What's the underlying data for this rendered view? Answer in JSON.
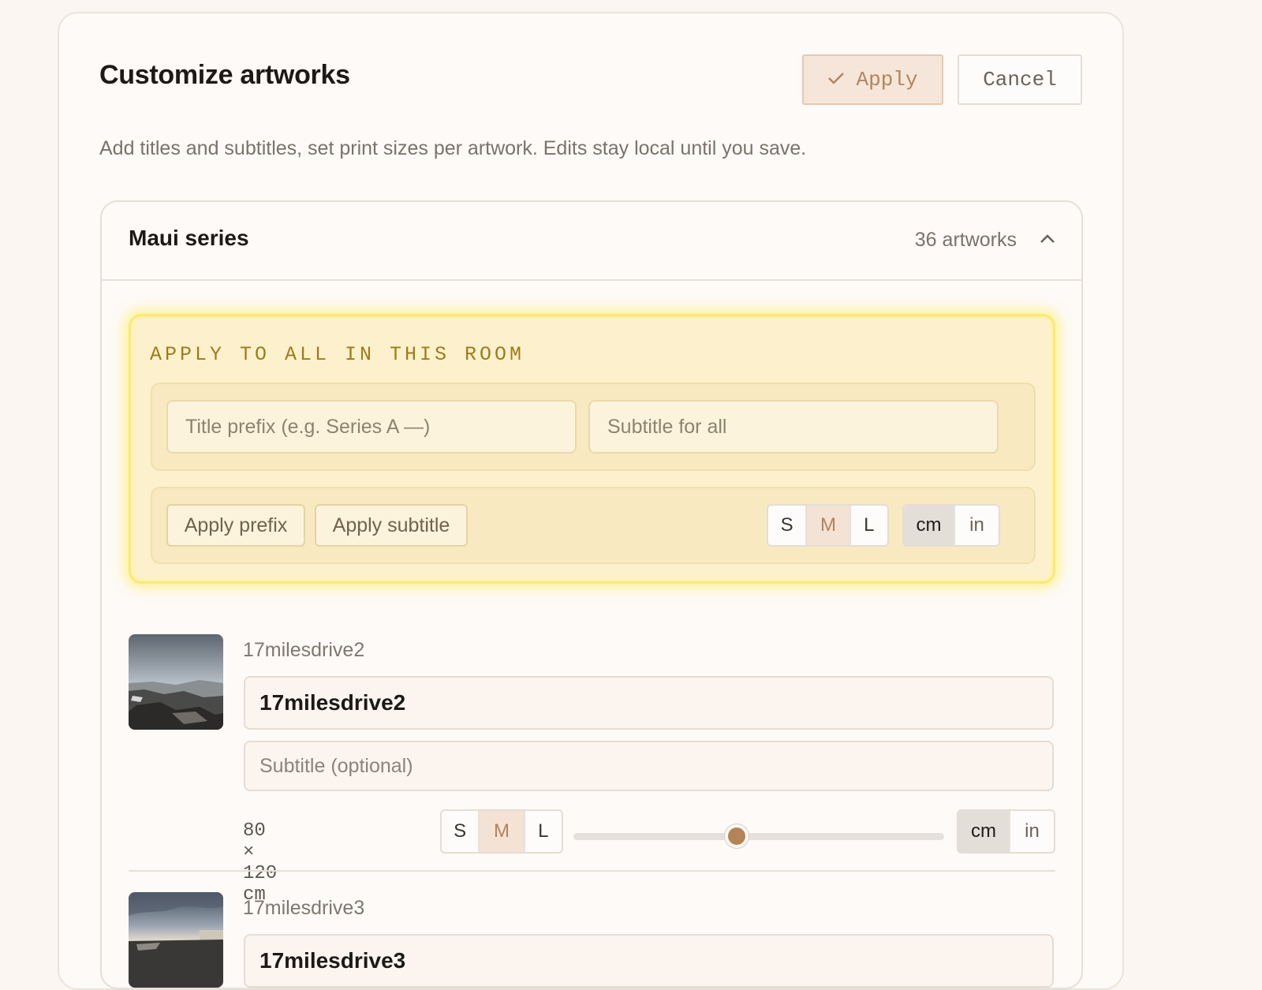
{
  "dialog": {
    "title": "Customize artworks",
    "apply_label": "Apply",
    "cancel_label": "Cancel",
    "description": "Add titles and subtitles, set print sizes per artwork. Edits stay local until you save."
  },
  "group": {
    "title": "Maui series",
    "count": "36 artworks",
    "expanded": true
  },
  "bulk": {
    "label": "APPLY TO ALL IN THIS ROOM",
    "title_prefix_placeholder": "Title prefix (e.g. Series A —)",
    "subtitle_placeholder": "Subtitle for all",
    "apply_prefix_label": "Apply prefix",
    "apply_subtitle_label": "Apply subtitle",
    "sizes": [
      "S",
      "M",
      "L"
    ],
    "selected_size": "M",
    "units": [
      "cm",
      "in"
    ],
    "selected_unit": "cm"
  },
  "artworks": [
    {
      "filename": "17milesdrive2",
      "title": "17milesdrive2",
      "subtitle_placeholder": "Subtitle (optional)",
      "dimensions": "80 × 120 cm",
      "sizes": [
        "S",
        "M",
        "L"
      ],
      "selected_size": "M",
      "slider_value": 0.44,
      "units": [
        "cm",
        "in"
      ],
      "selected_unit": "cm"
    },
    {
      "filename": "17milesdrive3",
      "title": "17milesdrive3"
    }
  ],
  "colors": {
    "accent": "#b58358",
    "highlight": "#fbe87a"
  }
}
